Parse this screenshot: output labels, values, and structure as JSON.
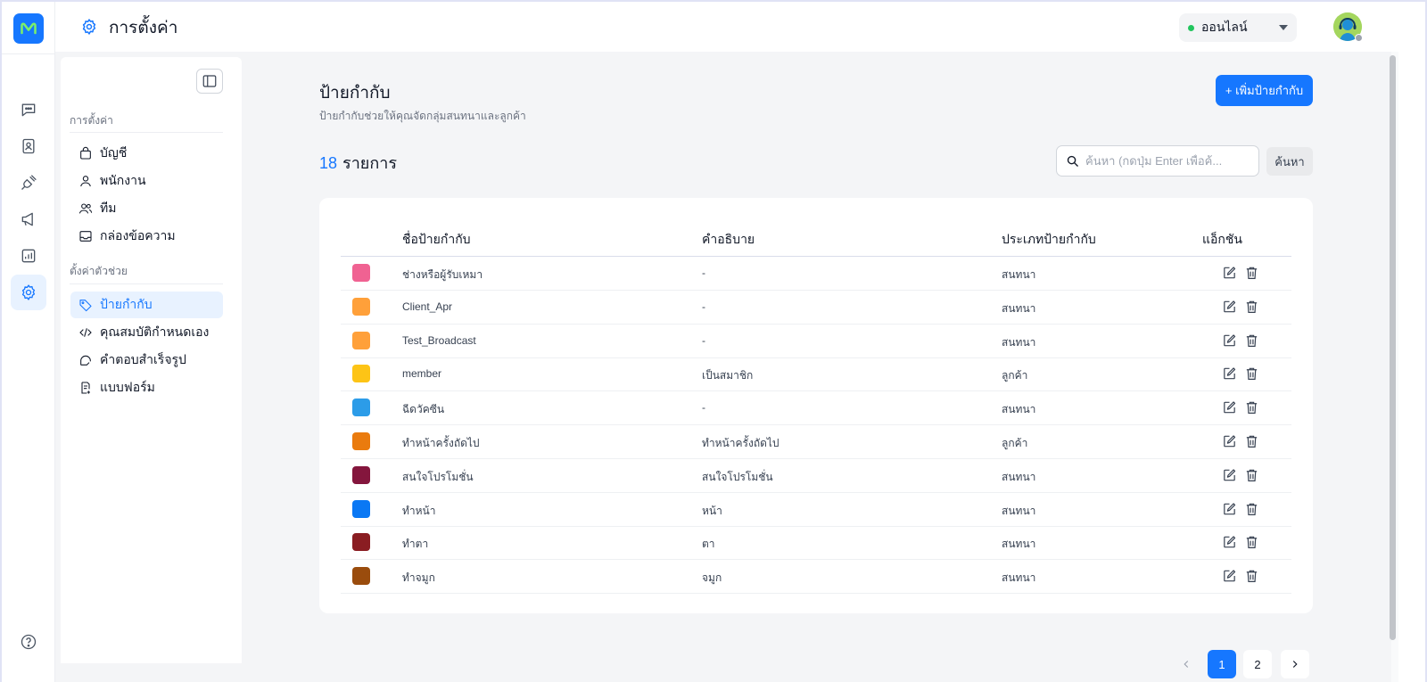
{
  "header": {
    "title": "การตั้งค่า",
    "status_label": "ออนไลน์"
  },
  "rail": {
    "items": [
      "chat-icon",
      "contact-icon",
      "plug-icon",
      "megaphone-icon",
      "chart-icon",
      "settings-icon"
    ],
    "active": "settings-icon"
  },
  "sidebar": {
    "section1": "การตั้งค่า",
    "items1": [
      {
        "label": "บัญชี",
        "icon": "bag-icon"
      },
      {
        "label": "พนักงาน",
        "icon": "user-icon"
      },
      {
        "label": "ทีม",
        "icon": "users-icon"
      },
      {
        "label": "กล่องข้อความ",
        "icon": "inbox-icon"
      }
    ],
    "section2": "ตั้งค่าตัวช่วย",
    "items2": [
      {
        "label": "ป้ายกำกับ",
        "icon": "tag-icon"
      },
      {
        "label": "คุณสมบัติกำหนดเอง",
        "icon": "code-icon"
      },
      {
        "label": "คำตอบสำเร็จรูป",
        "icon": "canned-icon"
      },
      {
        "label": "แบบฟอร์ม",
        "icon": "form-icon"
      }
    ]
  },
  "main": {
    "title": "ป้ายกำกับ",
    "subtitle": "ป้ายกำกับช่วยให้คุณจัดกลุ่มสนทนาและลูกค้า",
    "add_button": "+ เพิ่มป้ายกำกับ",
    "count": "18",
    "count_label": "รายการ",
    "search_placeholder": "ค้นหา (กดปุ่ม Enter เพื่อค้...",
    "search_button": "ค้นหา"
  },
  "table": {
    "columns": [
      "ชื่อป้ายกำกับ",
      "คำอธิบาย",
      "ประเภทป้ายกำกับ",
      "แอ็กชัน"
    ],
    "rows": [
      {
        "color": "#f06292",
        "name": "ช่างหรือผู้รับเหมา",
        "desc": "-",
        "type": "สนทนา"
      },
      {
        "color": "#ffa03a",
        "name": "Client_Apr",
        "desc": "-",
        "type": "สนทนา"
      },
      {
        "color": "#ffa03a",
        "name": "Test_Broadcast",
        "desc": "-",
        "type": "สนทนา"
      },
      {
        "color": "#fdc416",
        "name": "member",
        "desc": "เป็นสมาชิก",
        "type": "ลูกค้า"
      },
      {
        "color": "#2c9ce8",
        "name": "ฉีดวัคซีน",
        "desc": "-",
        "type": "สนทนา"
      },
      {
        "color": "#ea7b0e",
        "name": "ทำหน้าครั้งถัดไป",
        "desc": "ทำหน้าครั้งถัดไป",
        "type": "ลูกค้า"
      },
      {
        "color": "#84163d",
        "name": "สนใจโปรโมชั่น",
        "desc": "สนใจโปรโมชั่น",
        "type": "สนทนา"
      },
      {
        "color": "#0a78f4",
        "name": "ทำหน้า",
        "desc": "หน้า",
        "type": "สนทนา"
      },
      {
        "color": "#8a1d22",
        "name": "ทำตา",
        "desc": "ตา",
        "type": "สนทนา"
      },
      {
        "color": "#9a4c0d",
        "name": "ทำจมูก",
        "desc": "จมูก",
        "type": "สนทนา"
      }
    ]
  },
  "pagination": {
    "pages": [
      "1",
      "2"
    ],
    "current": "1"
  }
}
